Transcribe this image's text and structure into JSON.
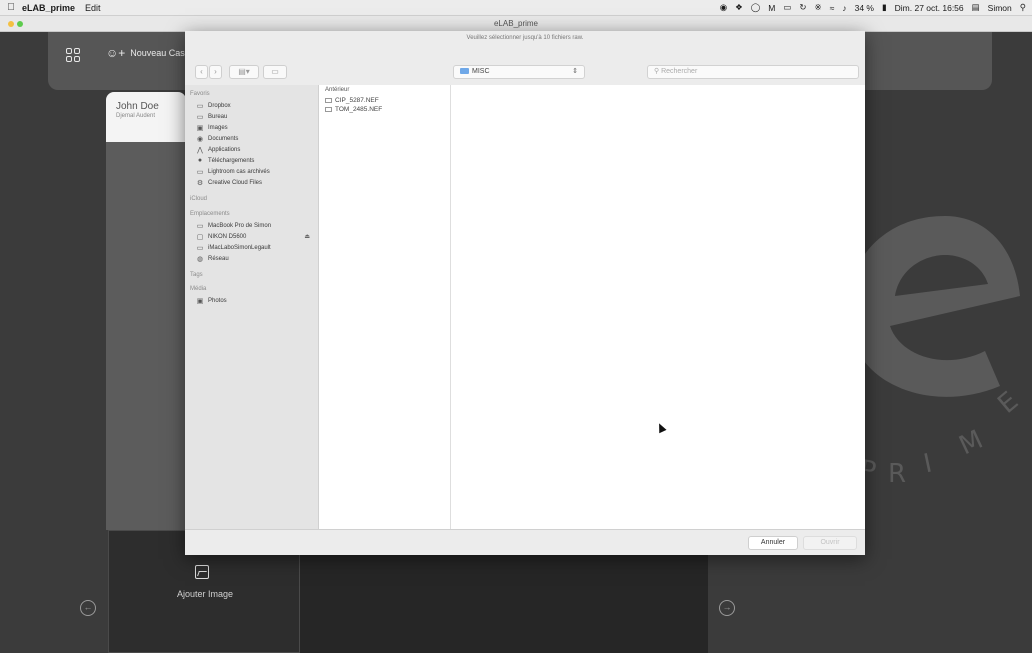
{
  "menubar": {
    "apple_icon": "apple-icon",
    "app_name": "eLAB_prime",
    "menu_edit": "Edit",
    "battery": "34 %",
    "datetime": "Dim. 27 oct. 16:56",
    "user": "Simon"
  },
  "window": {
    "title": "eLAB_prime"
  },
  "toolbar": {
    "new_case_label": "Nouveau Cas"
  },
  "patient": {
    "name": "John Doe",
    "subtitle": "Djemal Audent"
  },
  "bottom": {
    "add_image_label": "Ajouter Image"
  },
  "dialog": {
    "message": "Veuillez sélectionner jusqu'à 10 fichiers raw.",
    "location": "MISC",
    "search_placeholder": "Rechercher",
    "sidebar": {
      "favoris_label": "Favoris",
      "favoris": [
        "Dropbox",
        "Bureau",
        "Images",
        "Documents",
        "Applications",
        "Téléchargements",
        "Lightroom cas archivés",
        "Creative Cloud Files"
      ],
      "icloud_label": "iCloud",
      "emplacements_label": "Emplacements",
      "emplacements": [
        "MacBook Pro de Simon",
        "NIKON D5600",
        "iMacLaboSimonLegault",
        "Réseau"
      ],
      "tags_label": "Tags",
      "media_label": "Média",
      "media": [
        "Photos"
      ]
    },
    "column_header": "Antérieur",
    "files": [
      "CIP_5287.NEF",
      "TOM_2485.NEF"
    ],
    "cancel_label": "Annuler",
    "open_label": "Ouvrir"
  },
  "logo": {
    "letters": [
      "E",
      "M",
      "I",
      "R",
      "P"
    ]
  }
}
